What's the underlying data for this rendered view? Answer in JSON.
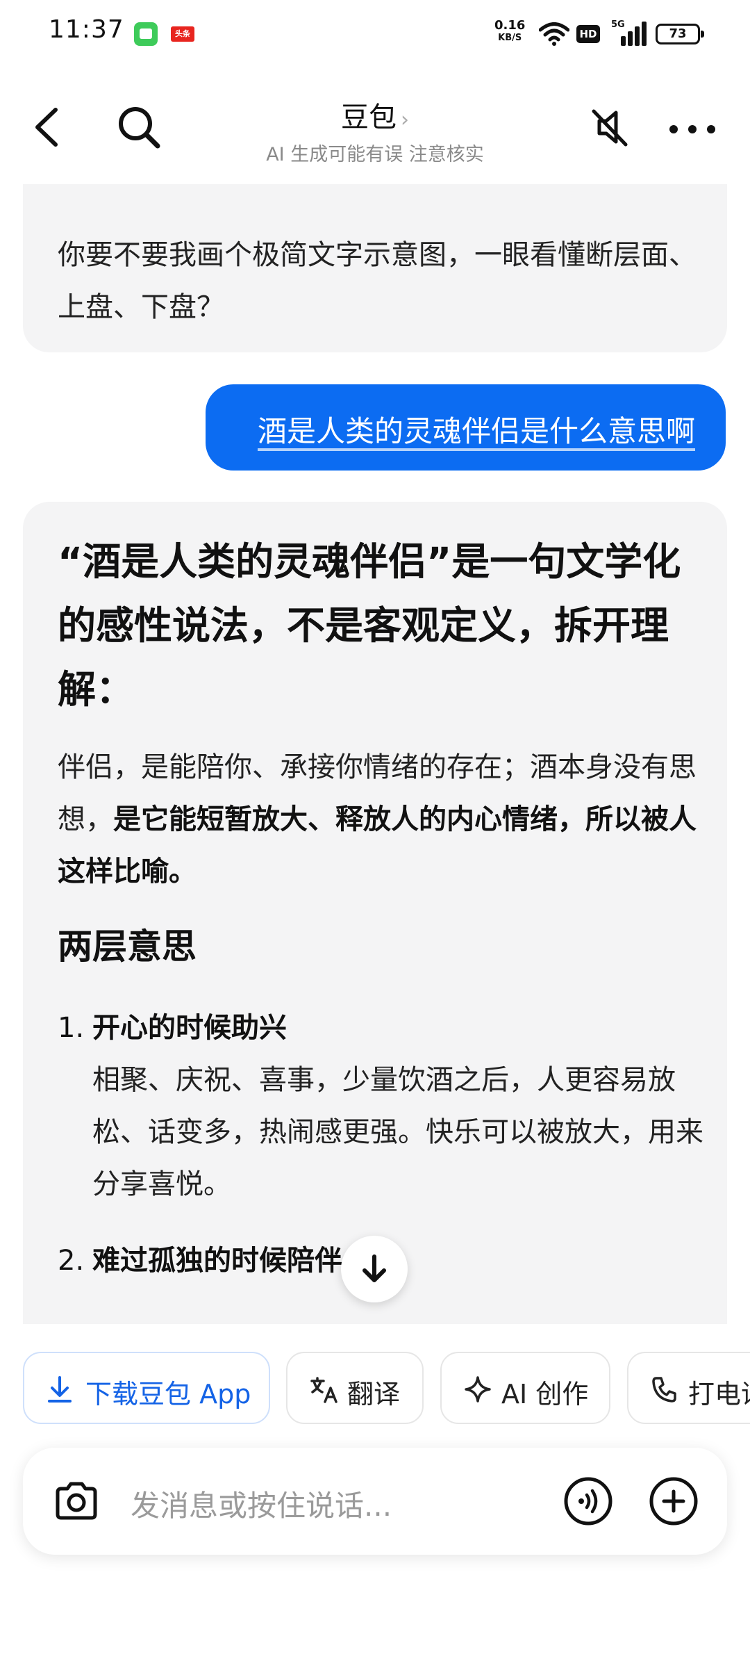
{
  "status_bar": {
    "time": "11:37",
    "net_speed": "0.16",
    "net_speed_unit": "KB/S",
    "hd_label": "HD",
    "signal_label": "5G",
    "battery": "73"
  },
  "nav": {
    "title": "豆包",
    "title_chevron": "›",
    "subtitle": "AI 生成可能有误 注意核实"
  },
  "messages": {
    "ai_prev_text": "你要不要我画个极简文字示意图，一眼看懂断层面、上盘、下盘？",
    "user_text": "酒是人类的灵魂伴侣是什么意思啊",
    "ai_heading": "“酒是人类的灵魂伴侣”是一句文学化的感性说法，不是客观定义，拆开理解：",
    "ai_para_normal": "伴侣，是能陪你、承接你情绪的存在；酒本身没有思想，",
    "ai_para_bold": "是它能短暂放大、释放人的内心情绪，所以被人这样比喻。",
    "section_title": "两层意思",
    "list": [
      {
        "num": "1.",
        "head": "开心的时候助兴",
        "body": "相聚、庆祝、喜事，少量饮酒之后，人更容易放松、话变多，热闹感更强。快乐可以被放大，用来分享喜悦。"
      },
      {
        "num": "2.",
        "head": "难过孤独的时候陪伴",
        "body": ""
      }
    ]
  },
  "chips": {
    "download": "下载豆包 App",
    "translate": "翻译",
    "create": "AI 创作",
    "call": "打电话"
  },
  "input": {
    "placeholder": "发消息或按住说话..."
  },
  "colors": {
    "accent": "#0c6cf2",
    "link_blue": "#1463e6",
    "bubble_gray": "#f4f4f5"
  }
}
